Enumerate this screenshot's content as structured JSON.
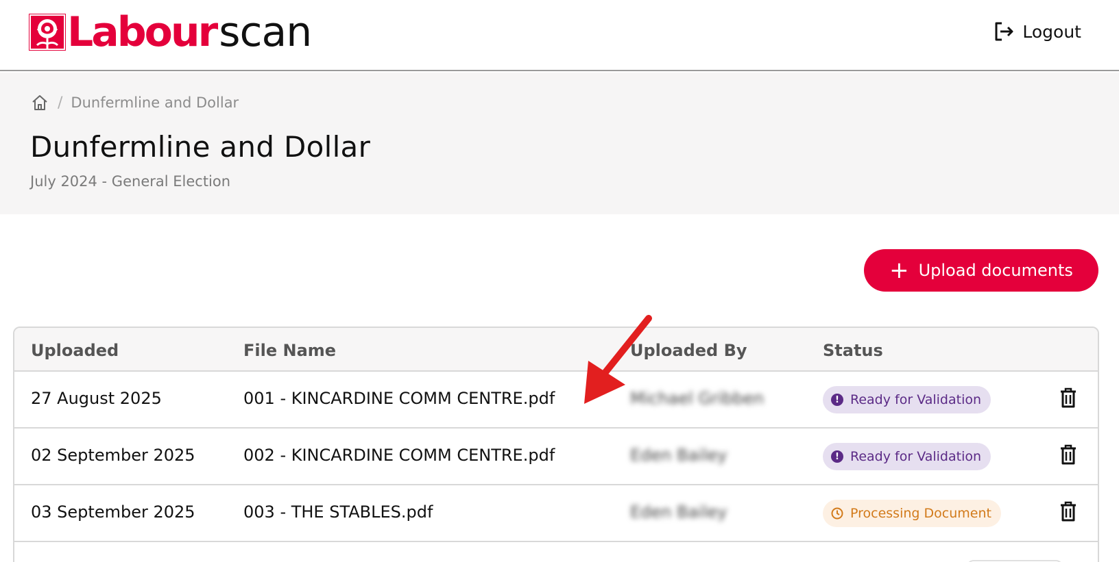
{
  "header": {
    "logo_primary": "Labour",
    "logo_secondary": "scan",
    "logout_label": "Logout"
  },
  "breadcrumb": {
    "current": "Dunfermline and Dollar"
  },
  "page": {
    "title": "Dunfermline and Dollar",
    "subtitle": "July 2024 - General Election"
  },
  "actions": {
    "upload_label": "Upload documents"
  },
  "table": {
    "columns": [
      "Uploaded",
      "File Name",
      "Uploaded By",
      "Status"
    ],
    "rows": [
      {
        "uploaded": "27 August 2025",
        "file_name": "001 - KINCARDINE COMM CENTRE.pdf",
        "uploaded_by": "Michael Gribben",
        "status": "Ready for Validation",
        "status_kind": "ready"
      },
      {
        "uploaded": "02 September 2025",
        "file_name": "002 - KINCARDINE COMM CENTRE.pdf",
        "uploaded_by": "Eden Bailey",
        "status": "Ready for Validation",
        "status_kind": "ready"
      },
      {
        "uploaded": "03 September 2025",
        "file_name": "003 - THE STABLES.pdf",
        "uploaded_by": "Eden Bailey",
        "status": "Processing Document",
        "status_kind": "processing"
      }
    ]
  },
  "icons": {
    "logo": "rose-icon",
    "logout": "logout-icon",
    "home": "home-icon",
    "upload": "plus-icon",
    "delete": "trash-icon",
    "ready": "info-icon",
    "processing": "clock-icon"
  },
  "colors": {
    "brand": "#e4003b",
    "ready_bg": "#e6dff0",
    "ready_text": "#5b2a86",
    "processing_bg": "#fdf0e3",
    "processing_text": "#d27a1a",
    "annotation_arrow": "#e21f1f"
  }
}
